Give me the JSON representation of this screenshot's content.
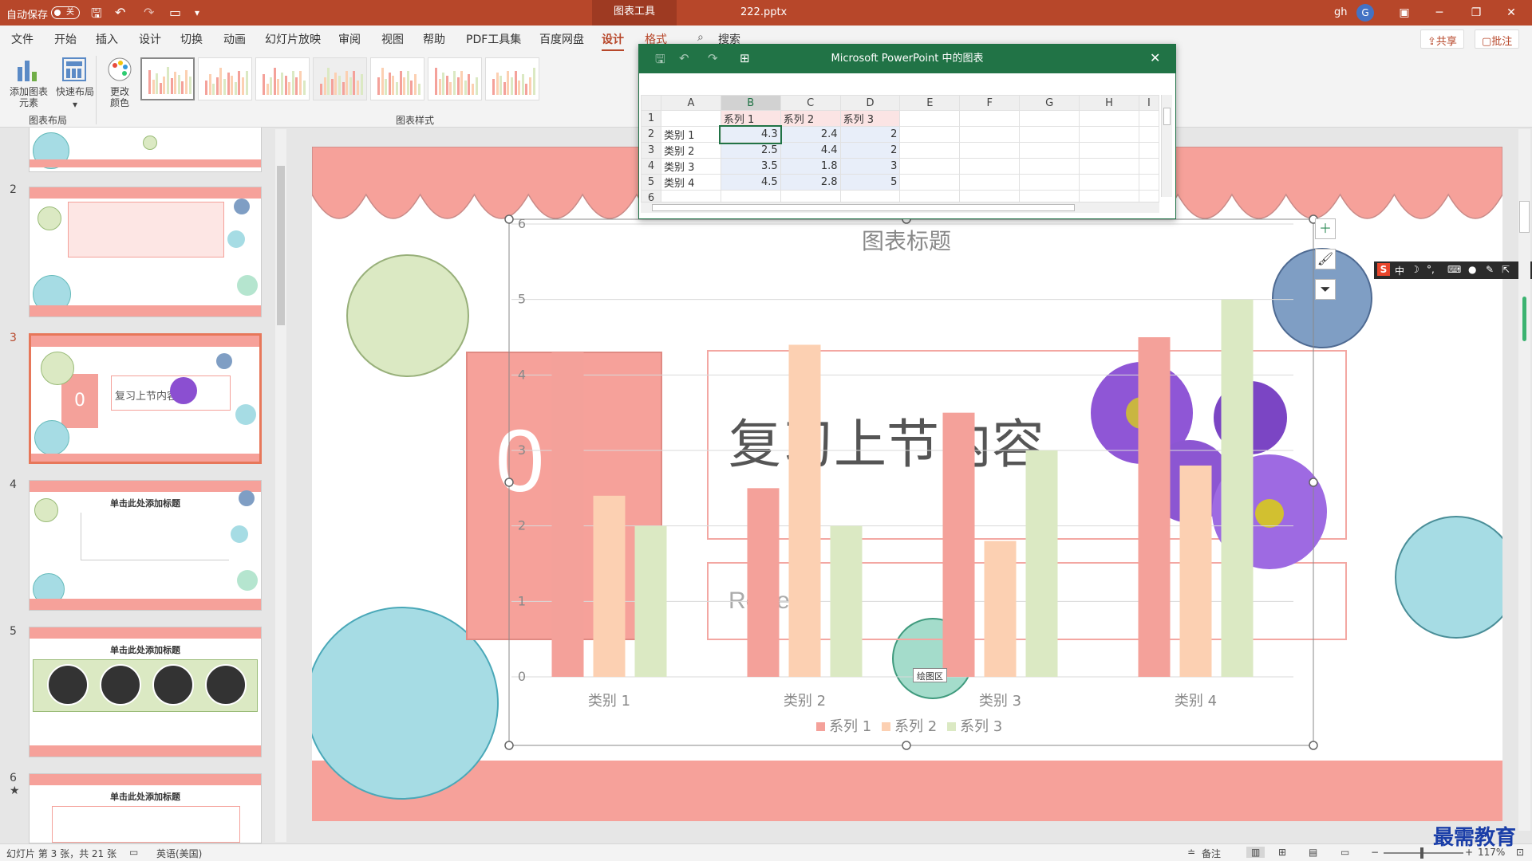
{
  "titlebar": {
    "autosave_label": "自动保存",
    "autosave_state": "关",
    "context_tab": "图表工具",
    "filename": "222.pptx",
    "user": "gh",
    "avatar_letter": "G"
  },
  "menu": {
    "tabs": [
      "文件",
      "开始",
      "插入",
      "设计",
      "切换",
      "动画",
      "幻灯片放映",
      "审阅",
      "视图",
      "帮助",
      "PDF工具集",
      "百度网盘",
      "设计",
      "格式"
    ],
    "search": "搜索",
    "share": "共享",
    "comment": "批注"
  },
  "ribbon": {
    "add_element": "添加图表\n元素",
    "quick_layout": "快速布局",
    "change_color": "更改\n颜色",
    "group_layout": "图表布局",
    "group_styles": "图表样式"
  },
  "slides": {
    "numbers": [
      "2",
      "3",
      "4",
      "5",
      "6"
    ],
    "slide6_star": "★",
    "thumb_title": "单击此处添加标题",
    "thumb3_text": "复习上节内容",
    "thumb3_num": "0"
  },
  "excel": {
    "title": "Microsoft PowerPoint 中的图表",
    "columns": [
      "A",
      "B",
      "C",
      "D",
      "E",
      "F",
      "G",
      "H",
      "I"
    ],
    "rows": [
      [
        "1",
        "",
        "系列 1",
        "系列 2",
        "系列 3"
      ],
      [
        "2",
        "类别 1",
        "4.3",
        "2.4",
        "2"
      ],
      [
        "3",
        "类别 2",
        "2.5",
        "4.4",
        "2"
      ],
      [
        "4",
        "类别 3",
        "3.5",
        "1.8",
        "3"
      ],
      [
        "5",
        "类别 4",
        "4.5",
        "2.8",
        "5"
      ],
      [
        "6",
        "",
        "",
        "",
        ""
      ]
    ]
  },
  "slide": {
    "heading": "复习上节内容",
    "subheading": "Review",
    "big_number": "0",
    "plot_area_tag": "绘图区"
  },
  "chart_data": {
    "type": "bar",
    "title": "图表标题",
    "categories": [
      "类别 1",
      "类别 2",
      "类别 3",
      "类别 4"
    ],
    "series": [
      {
        "name": "系列 1",
        "values": [
          4.3,
          2.5,
          3.5,
          4.5
        ],
        "color": "#f4a19a"
      },
      {
        "name": "系列 2",
        "values": [
          2.4,
          4.4,
          1.8,
          2.8
        ],
        "color": "#fcd0b2"
      },
      {
        "name": "系列 3",
        "values": [
          2,
          2,
          3,
          5
        ],
        "color": "#dbe9c3"
      }
    ],
    "ylim": [
      0,
      6
    ],
    "yticks": [
      "0",
      "1",
      "2",
      "3",
      "4",
      "5",
      "6"
    ],
    "legend": "bottom",
    "grid": true
  },
  "ime": "中",
  "status": {
    "slide_info": "幻灯片 第 3 张，共 21 张",
    "language": "英语(美国)",
    "notes": "备注",
    "zoom": "117%"
  },
  "watermark": "最需教育",
  "colors": {
    "accent": "#b7472a",
    "excel_green": "#217346",
    "scallop": "#f6a19a",
    "circle_blue": "#a6dce4",
    "circle_green": "#dbe9c3",
    "circle_navy": "#7f9ec4"
  }
}
